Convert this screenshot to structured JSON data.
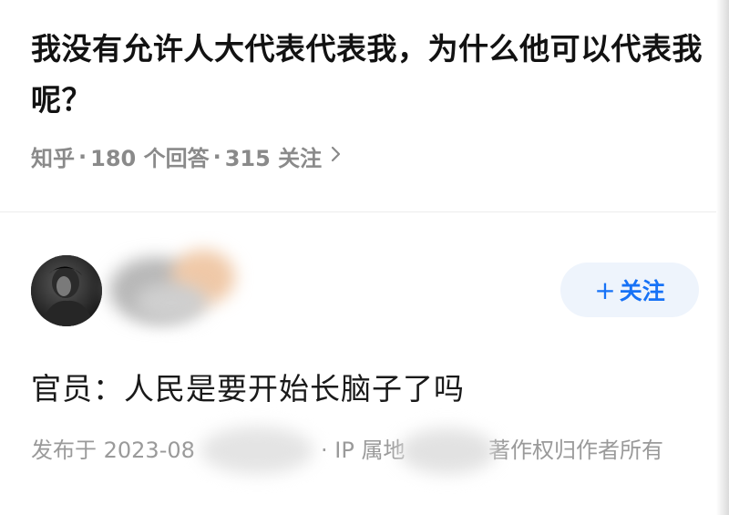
{
  "question": {
    "title": "我没有允许人大代表代表我，为什么他可以代表我呢？",
    "meta": {
      "source": "知乎",
      "answers": "180 个回答",
      "followers": "315 关注",
      "chevron_icon": "chevron-right-icon"
    }
  },
  "answer": {
    "author": {
      "avatar_icon": "user-avatar",
      "name_redacted": true
    },
    "follow_button": {
      "label": "关注",
      "plus_icon": "+",
      "accent": "#1772f6",
      "background": "#eef4fc"
    },
    "content": "官员：人民是要开始长脑子了吗",
    "footer": {
      "published": "发布于 2023-08",
      "ip_label": "· IP 属地",
      "copyright": "著作权归作者所有"
    }
  }
}
